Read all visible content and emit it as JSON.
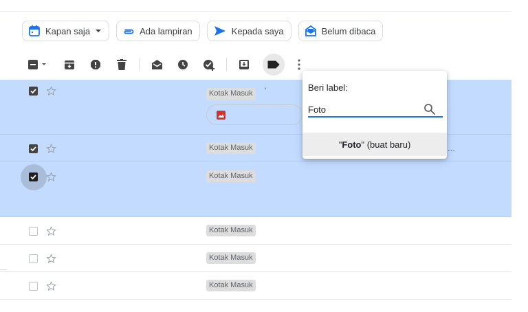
{
  "chips": [
    {
      "icon": "calendar-icon",
      "label": "Kapan saja",
      "dropdown": true
    },
    {
      "icon": "attachment-icon",
      "label": "Ada lampiran"
    },
    {
      "icon": "send-icon",
      "label": "Kepada saya"
    },
    {
      "icon": "mark-read-icon",
      "label": "Belum dibaca"
    }
  ],
  "rows": [
    {
      "label": "Kotak Masuk",
      "mark": "'",
      "checked": true
    },
    {
      "label": "Kotak Masuk",
      "checked": true
    },
    {
      "label": "Kotak Masuk",
      "checked": true
    },
    {
      "label": "Kotak Masuk",
      "checked": false
    },
    {
      "label": "Kotak Masuk",
      "checked": false
    },
    {
      "label": "Kotak Masuk",
      "checked": false
    }
  ],
  "popup": {
    "title": "Beri label:",
    "input_value": "Foto",
    "create_quote_open": "\"",
    "create_name": "Foto",
    "create_quote_close": "\"",
    "create_suffix": " (buat baru)"
  },
  "truncation": "...",
  "colors": {
    "selected_row": "#c2dbff",
    "accent": "#1a73e8",
    "chip_icon": "#1a73e8",
    "attachment_red": "#d93025"
  }
}
